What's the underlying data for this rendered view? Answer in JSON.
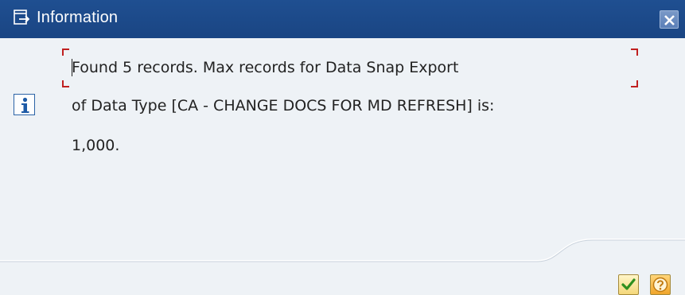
{
  "window": {
    "title": "Information",
    "icons": {
      "window": "window-arrow-icon",
      "close": "close-icon"
    }
  },
  "message": {
    "icon": "info-icon",
    "lines": [
      "Found 5 records. Max records for Data Snap Export",
      "of Data Type [CA - CHANGE DOCS FOR MD REFRESH] is:",
      "1,000."
    ]
  },
  "footer": {
    "buttons": [
      {
        "name": "continue-button",
        "icon": "checkmark-icon"
      },
      {
        "name": "help-button",
        "icon": "question-icon"
      }
    ]
  },
  "colors": {
    "titlebar": "#1c4a8a",
    "background": "#eef2f6",
    "focus_bracket": "#c02020"
  }
}
